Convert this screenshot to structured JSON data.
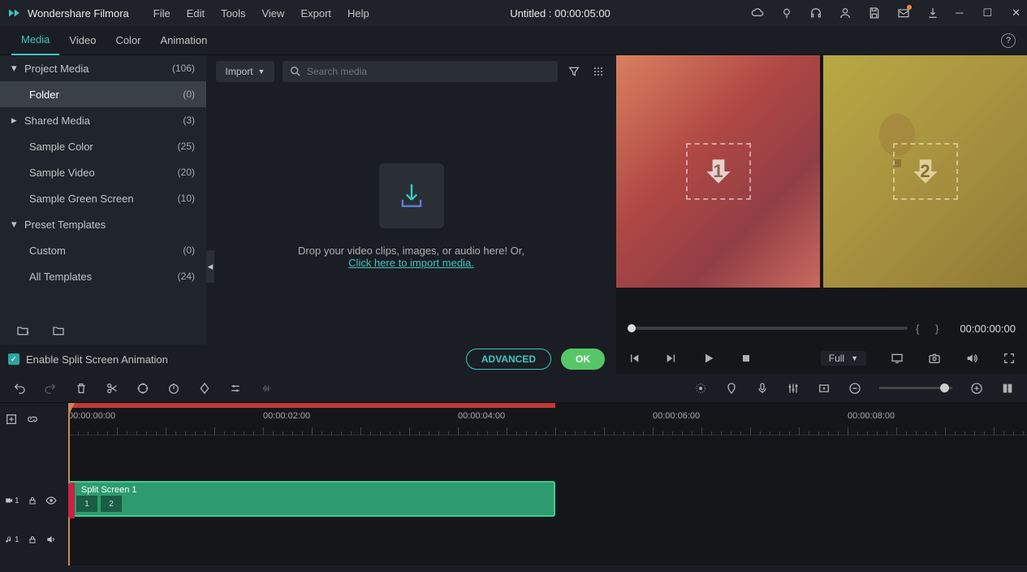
{
  "app": {
    "name": "Wondershare Filmora",
    "title": "Untitled : 00:00:05:00"
  },
  "menu": [
    "File",
    "Edit",
    "Tools",
    "View",
    "Export",
    "Help"
  ],
  "tabs": [
    "Media",
    "Video",
    "Color",
    "Animation"
  ],
  "sidebar": [
    {
      "label": "Project Media",
      "count": "(106)",
      "expand": true,
      "chev": "▾"
    },
    {
      "label": "Folder",
      "count": "(0)",
      "child": true,
      "selected": true
    },
    {
      "label": "Shared Media",
      "count": "(3)",
      "expand": true,
      "chev": "▸"
    },
    {
      "label": "Sample Color",
      "count": "(25)",
      "child": true
    },
    {
      "label": "Sample Video",
      "count": "(20)",
      "child": true
    },
    {
      "label": "Sample Green Screen",
      "count": "(10)",
      "child": true
    },
    {
      "label": "Preset Templates",
      "count": "",
      "expand": true,
      "chev": "▾"
    },
    {
      "label": "Custom",
      "count": "(0)",
      "child": true
    },
    {
      "label": "All Templates",
      "count": "(24)",
      "child": true
    }
  ],
  "split_check_label": "Enable Split Screen Animation",
  "buttons": {
    "advanced": "ADVANCED",
    "ok": "OK"
  },
  "import_label": "Import",
  "search_placeholder": "Search media",
  "drop": {
    "text": "Drop your video clips, images, or audio here! Or,",
    "link": "Click here to import media."
  },
  "preview": {
    "slot1": "1",
    "slot2": "2",
    "time": "00:00:00:00",
    "quality": "Full"
  },
  "ruler": [
    "00:00:00:00",
    "00:00:02:00",
    "00:00:04:00",
    "00:00:06:00",
    "00:00:08:00"
  ],
  "tracks": {
    "video": "1",
    "audio": "1"
  },
  "clip": {
    "title": "Split Screen 1",
    "thumb1": "1",
    "thumb2": "2"
  }
}
